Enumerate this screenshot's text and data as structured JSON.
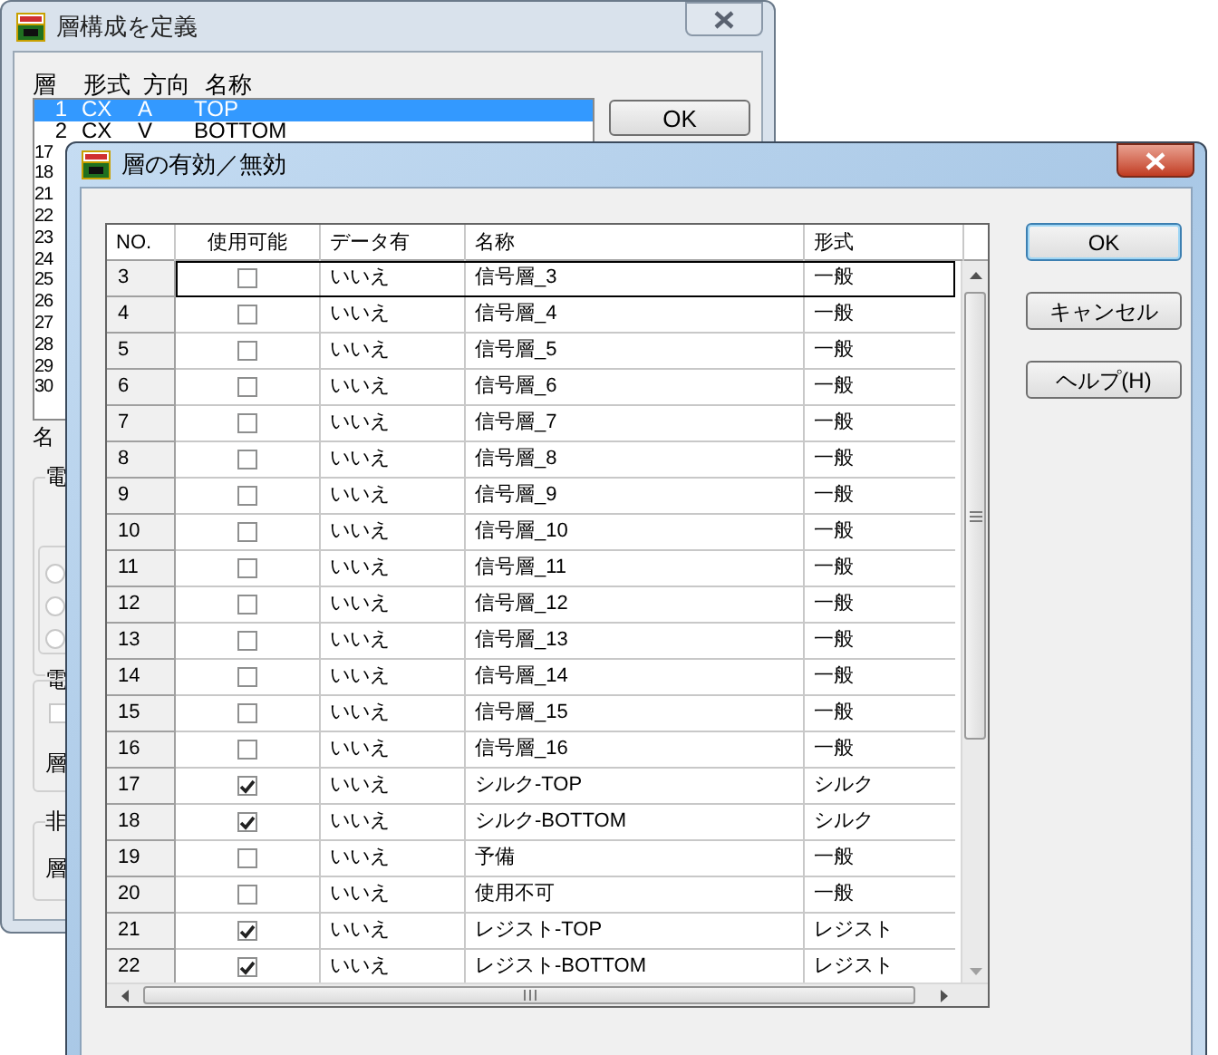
{
  "background_window": {
    "title": "層構成を定義",
    "list_header": [
      "層",
      "形式",
      "方向",
      "名称"
    ],
    "list_rows": [
      {
        "cells": [
          "1",
          "CX",
          "A",
          "TOP"
        ],
        "selected": true
      },
      {
        "cells": [
          "2",
          "CX",
          "V",
          "BOTTOM"
        ],
        "selected": false
      }
    ],
    "partial_rows": [
      "17",
      "18",
      "21",
      "22",
      "23",
      "24",
      "25",
      "26",
      "27",
      "28",
      "29",
      "30"
    ],
    "labels": [
      "名",
      "電",
      "電",
      "層",
      "非",
      "層"
    ],
    "radio_buttons": [
      {
        "selected": false
      },
      {
        "selected": false
      },
      {
        "selected": false
      }
    ],
    "checkbox": {
      "checked": false
    },
    "ok_button": "OK"
  },
  "dialog": {
    "title": "層の有効／無効",
    "columns": [
      "NO.",
      "使用可能",
      "データ有",
      "名称",
      "形式"
    ],
    "rows": [
      {
        "no": "3",
        "enabled": false,
        "has_data": "いいえ",
        "name": "信号層_3",
        "type": "一般",
        "focused": true
      },
      {
        "no": "4",
        "enabled": false,
        "has_data": "いいえ",
        "name": "信号層_4",
        "type": "一般",
        "focused": false
      },
      {
        "no": "5",
        "enabled": false,
        "has_data": "いいえ",
        "name": "信号層_5",
        "type": "一般",
        "focused": false
      },
      {
        "no": "6",
        "enabled": false,
        "has_data": "いいえ",
        "name": "信号層_6",
        "type": "一般",
        "focused": false
      },
      {
        "no": "7",
        "enabled": false,
        "has_data": "いいえ",
        "name": "信号層_7",
        "type": "一般",
        "focused": false
      },
      {
        "no": "8",
        "enabled": false,
        "has_data": "いいえ",
        "name": "信号層_8",
        "type": "一般",
        "focused": false
      },
      {
        "no": "9",
        "enabled": false,
        "has_data": "いいえ",
        "name": "信号層_9",
        "type": "一般",
        "focused": false
      },
      {
        "no": "10",
        "enabled": false,
        "has_data": "いいえ",
        "name": "信号層_10",
        "type": "一般",
        "focused": false
      },
      {
        "no": "11",
        "enabled": false,
        "has_data": "いいえ",
        "name": "信号層_11",
        "type": "一般",
        "focused": false
      },
      {
        "no": "12",
        "enabled": false,
        "has_data": "いいえ",
        "name": "信号層_12",
        "type": "一般",
        "focused": false
      },
      {
        "no": "13",
        "enabled": false,
        "has_data": "いいえ",
        "name": "信号層_13",
        "type": "一般",
        "focused": false
      },
      {
        "no": "14",
        "enabled": false,
        "has_data": "いいえ",
        "name": "信号層_14",
        "type": "一般",
        "focused": false
      },
      {
        "no": "15",
        "enabled": false,
        "has_data": "いいえ",
        "name": "信号層_15",
        "type": "一般",
        "focused": false
      },
      {
        "no": "16",
        "enabled": false,
        "has_data": "いいえ",
        "name": "信号層_16",
        "type": "一般",
        "focused": false
      },
      {
        "no": "17",
        "enabled": true,
        "has_data": "いいえ",
        "name": "シルク-TOP",
        "type": "シルク",
        "focused": false
      },
      {
        "no": "18",
        "enabled": true,
        "has_data": "いいえ",
        "name": "シルク-BOTTOM",
        "type": "シルク",
        "focused": false
      },
      {
        "no": "19",
        "enabled": false,
        "has_data": "いいえ",
        "name": "予備",
        "type": "一般",
        "focused": false
      },
      {
        "no": "20",
        "enabled": false,
        "has_data": "いいえ",
        "name": "使用不可",
        "type": "一般",
        "focused": false
      },
      {
        "no": "21",
        "enabled": true,
        "has_data": "いいえ",
        "name": "レジスト-TOP",
        "type": "レジスト",
        "focused": false
      },
      {
        "no": "22",
        "enabled": true,
        "has_data": "いいえ",
        "name": "レジスト-BOTTOM",
        "type": "レジスト",
        "focused": false
      }
    ],
    "buttons": [
      "OK",
      "キャンセル",
      "ヘルプ(H)"
    ]
  }
}
